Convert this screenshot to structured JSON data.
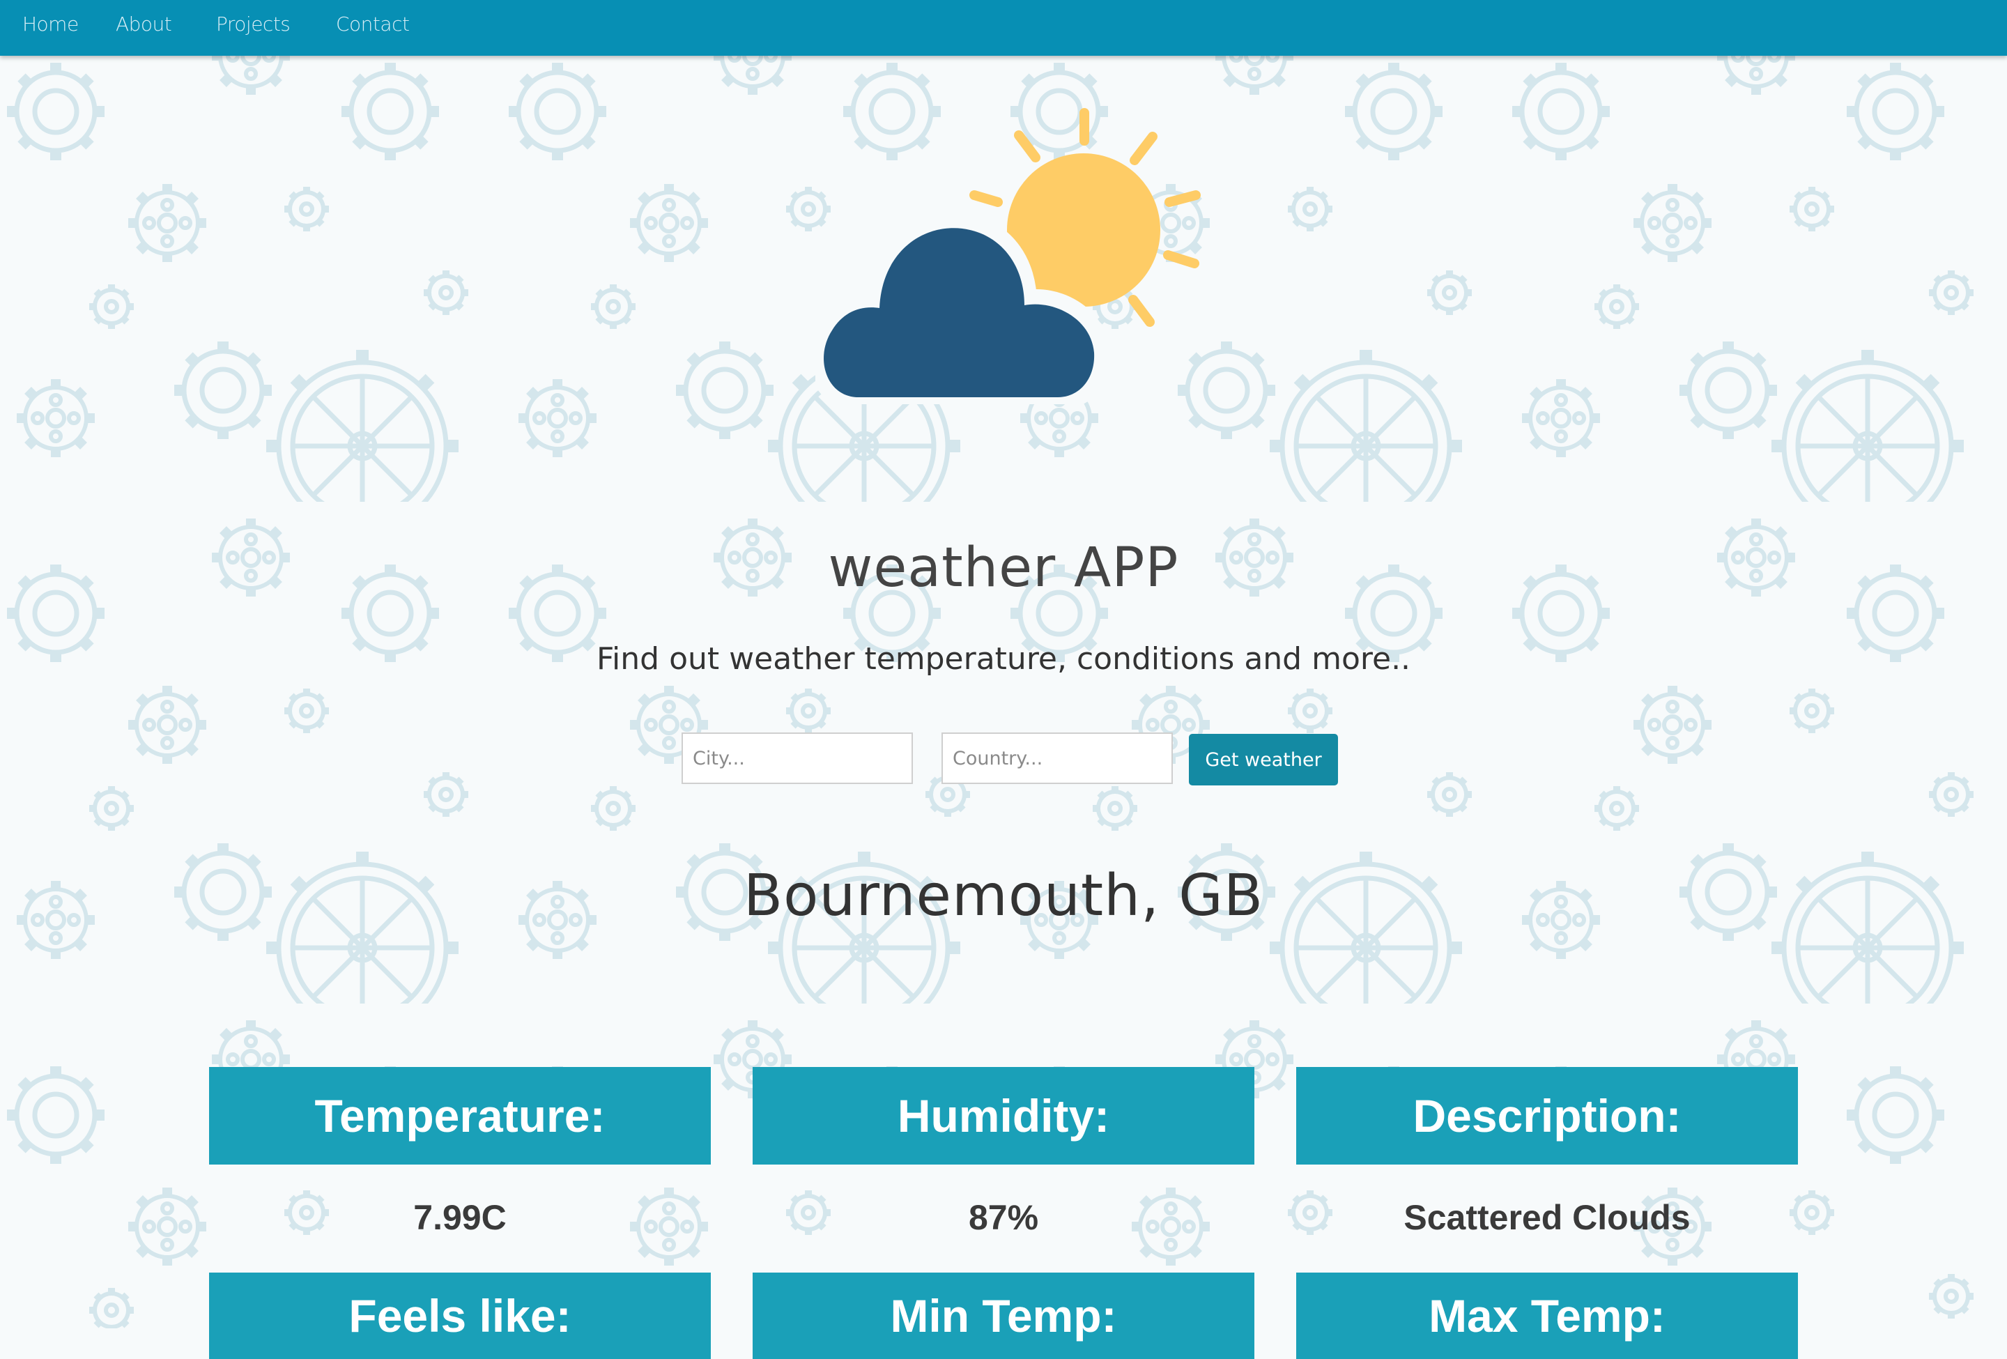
{
  "nav": {
    "items": [
      "Home",
      "About",
      "Projects",
      "Contact"
    ]
  },
  "logo": {
    "icon": "sun-cloud-icon",
    "colors": {
      "cloud": "#23577f",
      "sun": "#fecc66"
    }
  },
  "header": {
    "title": "weather APP",
    "subtitle": "Find out weather temperature, conditions and more.."
  },
  "form": {
    "city_placeholder": "City...",
    "city_value": "",
    "country_placeholder": "Country...",
    "country_value": "",
    "button_label": "Get weather"
  },
  "result": {
    "location": "Bournemouth, GB",
    "cards": [
      {
        "label": "Temperature:",
        "value": "7.99C"
      },
      {
        "label": "Humidity:",
        "value": "87%"
      },
      {
        "label": "Description:",
        "value": "Scattered Clouds"
      },
      {
        "label": "Feels like:",
        "value": ""
      },
      {
        "label": "Min Temp:",
        "value": ""
      },
      {
        "label": "Max Temp:",
        "value": ""
      }
    ]
  },
  "theme": {
    "navbar": "#078fb4",
    "card_header": "#1aa0b8",
    "button": "#148aa3",
    "pattern": "#d4e6ec"
  }
}
